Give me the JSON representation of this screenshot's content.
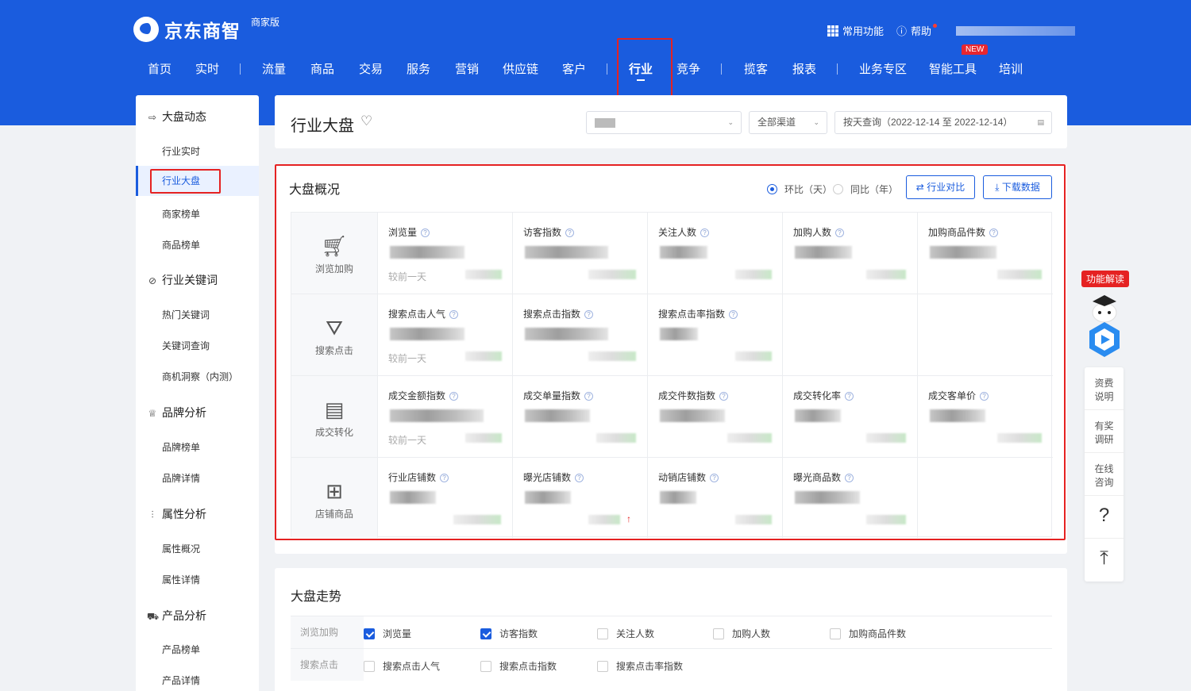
{
  "header": {
    "logo_text": "京东商智",
    "edition": "商家版",
    "tools": {
      "common": "常用功能",
      "help": "帮助"
    },
    "nav": [
      "首页",
      "实时",
      "流量",
      "商品",
      "交易",
      "服务",
      "营销",
      "供应链",
      "客户",
      "行业",
      "竞争",
      "揽客",
      "报表",
      "业务专区",
      "智能工具",
      "培训"
    ],
    "active_nav": "行业",
    "new_badge": "NEW"
  },
  "sidebar": {
    "groups": [
      {
        "label": "大盘动态",
        "icon": "dashboard-icon",
        "items": [
          "行业实时",
          "行业大盘",
          "商家榜单",
          "商品榜单"
        ]
      },
      {
        "label": "行业关键词",
        "icon": "keyword-icon",
        "items": [
          "热门关键词",
          "关键词查询",
          "商机洞察（内测）"
        ]
      },
      {
        "label": "品牌分析",
        "icon": "crown-icon",
        "items": [
          "品牌榜单",
          "品牌详情"
        ]
      },
      {
        "label": "属性分析",
        "icon": "sliders-icon",
        "items": [
          "属性概况",
          "属性详情"
        ]
      },
      {
        "label": "产品分析",
        "icon": "cart-icon",
        "items": [
          "产品榜单",
          "产品详情"
        ]
      }
    ],
    "active_item": "行业大盘"
  },
  "page": {
    "title": "行业大盘",
    "channel_select": "全部渠道",
    "date_select": "按天查询（2022-12-14 至 2022-12-14）"
  },
  "overview": {
    "title": "大盘概况",
    "radio_day": "环比（天）",
    "radio_year": "同比（年）",
    "btn_compare": "行业对比",
    "btn_download": "下载数据",
    "compare_text": "较前一天",
    "rows": [
      {
        "category": "浏览加购",
        "icon": "cart-icon",
        "metrics": [
          "浏览量",
          "访客指数",
          "关注人数",
          "加购人数",
          "加购商品件数"
        ]
      },
      {
        "category": "搜索点击",
        "icon": "filter-icon",
        "metrics": [
          "搜索点击人气",
          "搜索点击指数",
          "搜索点击率指数"
        ]
      },
      {
        "category": "成交转化",
        "icon": "document-icon",
        "metrics": [
          "成交金额指数",
          "成交单量指数",
          "成交件数指数",
          "成交转化率",
          "成交客单价"
        ]
      },
      {
        "category": "店铺商品",
        "icon": "grid-icon",
        "metrics": [
          "行业店铺数",
          "曝光店铺数",
          "动销店铺数",
          "曝光商品数"
        ]
      }
    ]
  },
  "trend": {
    "title": "大盘走势",
    "rows": [
      {
        "category": "浏览加购",
        "options": [
          {
            "label": "浏览量",
            "checked": true
          },
          {
            "label": "访客指数",
            "checked": true
          },
          {
            "label": "关注人数",
            "checked": false
          },
          {
            "label": "加购人数",
            "checked": false
          },
          {
            "label": "加购商品件数",
            "checked": false
          }
        ]
      },
      {
        "category": "搜索点击",
        "options": [
          {
            "label": "搜索点击人气",
            "checked": false
          },
          {
            "label": "搜索点击指数",
            "checked": false
          },
          {
            "label": "搜索点击率指数",
            "checked": false
          }
        ]
      }
    ]
  },
  "floatbar": {
    "function_label": "功能解读",
    "items": [
      "资费\n说明",
      "有奖\n调研",
      "在线\n咨询",
      "?"
    ]
  },
  "colors": {
    "brand": "#1a5cde",
    "highlight": "#e52222"
  }
}
